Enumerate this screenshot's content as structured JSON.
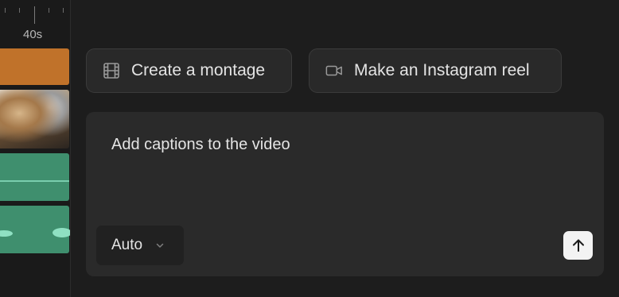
{
  "timeline": {
    "ruler_label": "40s"
  },
  "suggestions": [
    {
      "label": "Create a montage",
      "icon": "film-icon"
    },
    {
      "label": "Make an Instagram reel",
      "icon": "video-camera-icon"
    }
  ],
  "prompt": {
    "text": "Add captions to the video",
    "mode": "Auto",
    "mode_icon": "chevron-down-icon",
    "send_icon": "arrow-up-icon"
  },
  "colors": {
    "background": "#1d1d1d",
    "chip_background": "#292929",
    "prompt_background": "#2a2a2a",
    "track_orange": "#c0722a",
    "track_green": "#3f8f6e",
    "send_button": "#f3f3f3"
  }
}
